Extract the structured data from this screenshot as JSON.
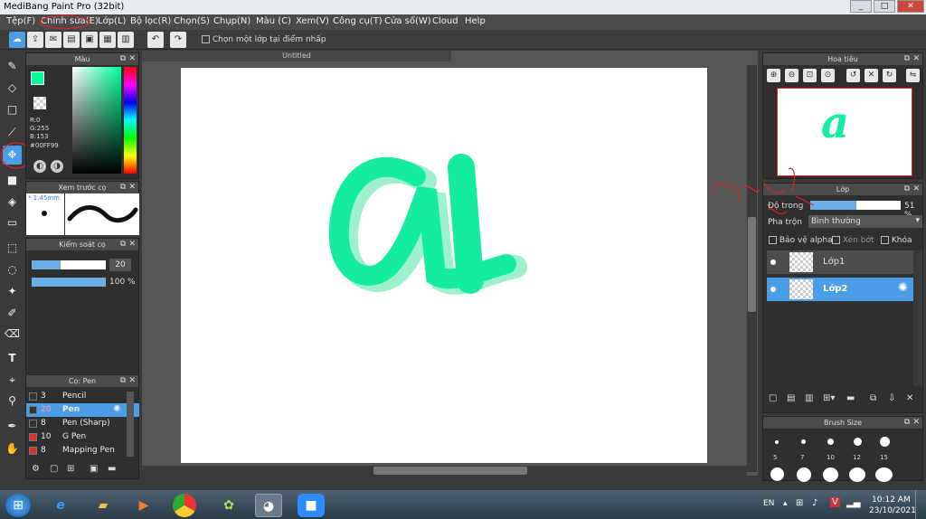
{
  "window": {
    "title": "MediBang Paint Pro (32bit)",
    "minimize": "_",
    "maximize": "□",
    "close": "✕"
  },
  "menu": [
    "Tệp(F)",
    "Chỉnh sửa(E)",
    "Lớp(L)",
    "Bộ lọc(R)",
    "Chọn(S)",
    "Chụp(N)",
    "Màu (C)",
    "Xem(V)",
    "Công cụ(T)",
    "Cửa sổ(W)",
    "Cloud",
    "Help"
  ],
  "toolbar": {
    "select_layer_label": "Chọn một lớp tại điểm nhấp"
  },
  "color_panel": {
    "title": "Màu",
    "r": "R:0",
    "g": "G:255",
    "b": "B:153",
    "hex": "#00FF99",
    "primary_color": "#00ff99"
  },
  "brush_preview": {
    "title": "Xem trước cọ",
    "size": "* 1.45mm"
  },
  "brush_control": {
    "title": "Kiểm soát cọ",
    "size_value": "20",
    "opacity_value": "100 %",
    "size_fraction": 0.39,
    "opacity_fraction": 1.0
  },
  "brush_list": {
    "title": "Cọ: Pen",
    "items": [
      {
        "size": "3",
        "name": "Pencil",
        "color": "#333333",
        "selected": false
      },
      {
        "size": "20",
        "name": "Pen",
        "color": "#333333",
        "selected": true
      },
      {
        "size": "8",
        "name": "Pen (Sharp)",
        "color": "#333333",
        "selected": false
      },
      {
        "size": "10",
        "name": "G Pen",
        "color": "#e03030",
        "selected": false
      },
      {
        "size": "8",
        "name": "Mapping Pen",
        "color": "#e03030",
        "selected": false
      }
    ]
  },
  "document": {
    "tab": "Untitled"
  },
  "navigator": {
    "title": "Hoa tiêu"
  },
  "layer_panel": {
    "title": "Lớp",
    "opacity_label": "Độ trong",
    "opacity_value": "51 %",
    "opacity_fraction": 0.51,
    "blend_label": "Pha trộn",
    "blend_value": "Bình thường",
    "protect_alpha": "Bảo vệ alpha",
    "clipping": "Xén bớt",
    "lock": "Khóa",
    "layers": [
      {
        "name": "Lớp1",
        "selected": false
      },
      {
        "name": "Lớp2",
        "selected": true
      }
    ]
  },
  "brush_size_panel": {
    "title": "Brush Size",
    "sizes": [
      "5",
      "7",
      "10",
      "12",
      "15"
    ]
  },
  "taskbar": {
    "lang": "EN",
    "time": "10:12 AM",
    "date": "23/10/2021"
  }
}
